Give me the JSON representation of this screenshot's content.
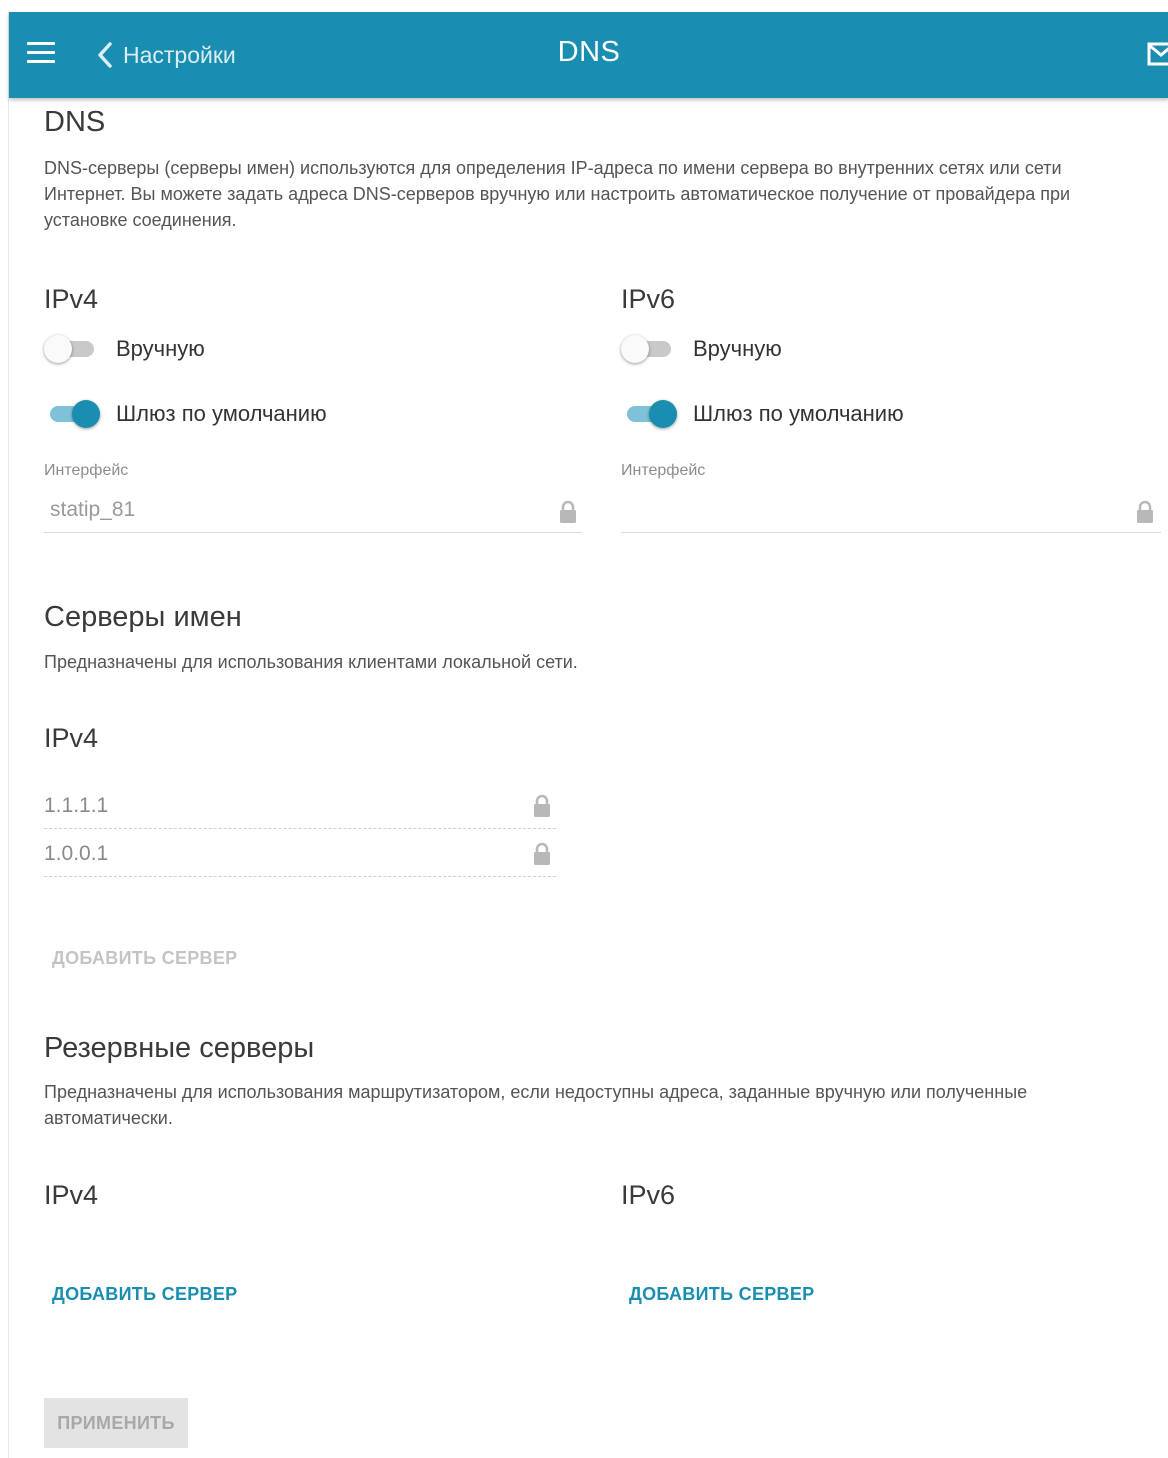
{
  "header": {
    "back_label": "Настройки",
    "title": "DNS"
  },
  "dns": {
    "title": "DNS",
    "description": "DNS-серверы (серверы имен) используются для определения IP-адреса по имени сервера во внутренних сетях или сети Интернет. Вы можете задать адреса DNS-серверов вручную или настроить автоматическое получение от провайдера при установке соединения.",
    "ipv4": {
      "title": "IPv4",
      "manual_label": "Вручную",
      "manual_on": false,
      "gateway_label": "Шлюз по умолчанию",
      "gateway_on": true,
      "interface_label": "Интерфейс",
      "interface_value": "statip_81"
    },
    "ipv6": {
      "title": "IPv6",
      "manual_label": "Вручную",
      "manual_on": false,
      "gateway_label": "Шлюз по умолчанию",
      "gateway_on": true,
      "interface_label": "Интерфейс",
      "interface_value": ""
    }
  },
  "name_servers": {
    "title": "Серверы имен",
    "description": "Предназначены для использования клиентами локальной сети.",
    "ipv4_title": "IPv4",
    "servers": [
      "1.1.1.1",
      "1.0.0.1"
    ],
    "add_label": "ДОБАВИТЬ СЕРВЕР"
  },
  "backup_servers": {
    "title": "Резервные серверы",
    "description": "Предназначены для использования маршрутизатором, если недоступны адреса, заданные вручную или полученные автоматически.",
    "ipv4_title": "IPv4",
    "ipv6_title": "IPv6",
    "add_ipv4_label": "ДОБАВИТЬ СЕРВЕР",
    "add_ipv6_label": "ДОБАВИТЬ СЕРВЕР"
  },
  "apply_label": "ПРИМЕНИТЬ",
  "colors": {
    "accent": "#1a8eb0",
    "toggle_track_on": "#7fc2d7",
    "disabled": "#c4c4c4"
  }
}
